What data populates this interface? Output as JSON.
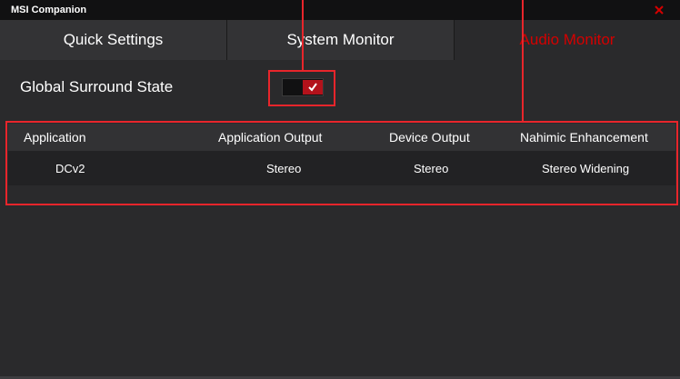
{
  "window": {
    "title": "MSI Companion"
  },
  "tabs": [
    {
      "label": "Quick Settings"
    },
    {
      "label": "System Monitor"
    },
    {
      "label": "Audio Monitor",
      "active": true
    }
  ],
  "surround": {
    "label": "Global Surround State",
    "enabled": true
  },
  "table": {
    "headers": [
      "Application",
      "Application Output",
      "Device Output",
      "Nahimic Enhancement"
    ],
    "rows": [
      [
        "DCv2",
        "Stereo",
        "Stereo",
        "Stereo Widening"
      ]
    ]
  },
  "colors": {
    "accent": "#e8252b",
    "active_tab_text": "#d40000",
    "background": "#2a2a2c"
  },
  "icons": {
    "close": "close-icon",
    "check": "check-icon"
  }
}
